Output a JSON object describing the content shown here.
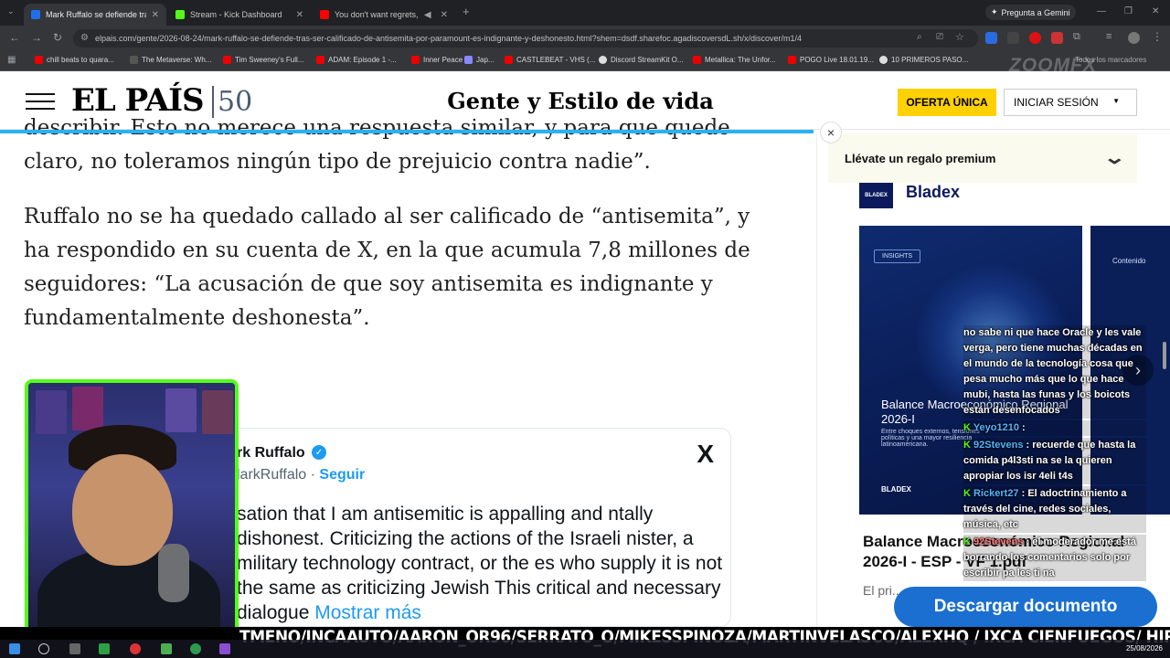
{
  "browser": {
    "tabs": [
      {
        "title": "Mark Ruffalo se defiende tras se",
        "active": true,
        "color": "#1f6feb"
      },
      {
        "title": "Stream - Kick Dashboard",
        "active": false,
        "color": "#53fc18"
      },
      {
        "title": "You don't want regrets, so",
        "active": false,
        "color": "#ff0000"
      }
    ],
    "new_tab": "+",
    "gemini_label": "Pregunta a Gemini",
    "url": "elpais.com/gente/2026-08-24/mark-ruffalo-se-defiende-tras-ser-calificado-de-antisemita-por-paramount-es-indignante-y-deshonesto.html?shem=dsdf.sharefoc.agadiscoversdL.sh/x/discover/m1/4",
    "bookmarks": [
      "chill beats to quara...",
      "The Metaverse: Wh...",
      "Tim Sweeney's Full...",
      "ADAM: Episode 1 -...",
      "Inner Peace",
      "Jap...",
      "CASTLEBEAT - VHS (...",
      "Discord StreamKit O...",
      "Metallica: The Unfor...",
      "POGO Live 18.01.19...",
      "10 PRIMEROS PASO...",
      "Todos los marcadores"
    ],
    "watermark": "ZOOMFX"
  },
  "site": {
    "logo": "EL PAÍS",
    "logo_badge": "50",
    "section_title": "Gente y Estilo de vida",
    "offer_button": "OFERTA ÚNICA",
    "login_button": "INICIAR SESIÓN"
  },
  "article": {
    "paragraph_top_1": "describir. Esto no merece una respuesta similar, y para que quede",
    "paragraph_top_2": "claro, no toleramos ningún tipo de prejuicio contra nadie”.",
    "paragraph_main": "Ruffalo no se ha quedado callado al ser calificado de “antisemita”, y ha respondido en su cuenta de X, en la que acumula 7,8 millones de seguidores: “La acusación de que soy antisemita es indignante y fundamentalmente deshonesta”."
  },
  "tweet": {
    "name": "rk Ruffalo",
    "handle": "larkRuffalo",
    "separator": "·",
    "follow": "Seguir",
    "x_logo": "X",
    "body": "sation that I am antisemitic is appalling and ntally dishonest. Criticizing the actions of the Israeli nister, a military technology contract, or the es who supply it is not the same as criticizing Jewish This critical and necessary dialogue",
    "more": "Mostrar más"
  },
  "sidebar": {
    "close": "×",
    "promo_label": "Llévate un regalo premium",
    "sponsor_logo": "BLADEX",
    "sponsor_name": "Bladex",
    "card_tag": "INSIGHTS",
    "card_title": "Balance Macroeconómico Regional 2026-I",
    "card_sub": "Entre choques externos, tensiones políticas y una mayor resiliencia latinoamericana.",
    "card_footer": "BLADEX",
    "card2_label": "Contenido",
    "doc_title": "Balance Macroeconómico Regional 2026-I - ESP - VF 1.pdf",
    "doc_desc": "El pri... por u...",
    "download_button": "Descargar documento"
  },
  "chat": [
    {
      "user": "",
      "text": "no sabe ni que hace Oracle y les vale verga, pero tiene muchas décadas en el mundo de la tecnología cosa que pesa mucho más que lo que hace mubi, hasta las funas y los boicots están desenfocados"
    },
    {
      "user": "Yeyo1210",
      "text": ""
    },
    {
      "user": "92Stevens",
      "text": "recuerde que hasta la comida p4l3sti na se la quieren apropiar los isr 4eli t4s"
    },
    {
      "user": "Rickert27",
      "text": "El adoctrinamiento a través del cine, redes sociales, música, etc"
    },
    {
      "user": "92Stevens",
      "text": "el moderador me está borrando los comentarios solo por escribir pa les ti na"
    }
  ],
  "ticker": "TMENO/INCAAUTO/AARON_OR96/SERRATO_O/MIKESSPINOZA/MARTINVELASCO/ALEXHQ / IXCA CIENFUEGOS/ HIPOLIO / EL_EM",
  "taskbar": {
    "date": "25/08/2026"
  },
  "colors": {
    "progress": "#28b2f0",
    "offer": "#ffd100",
    "download": "#1a6fd0",
    "kick": "#53fc18"
  }
}
